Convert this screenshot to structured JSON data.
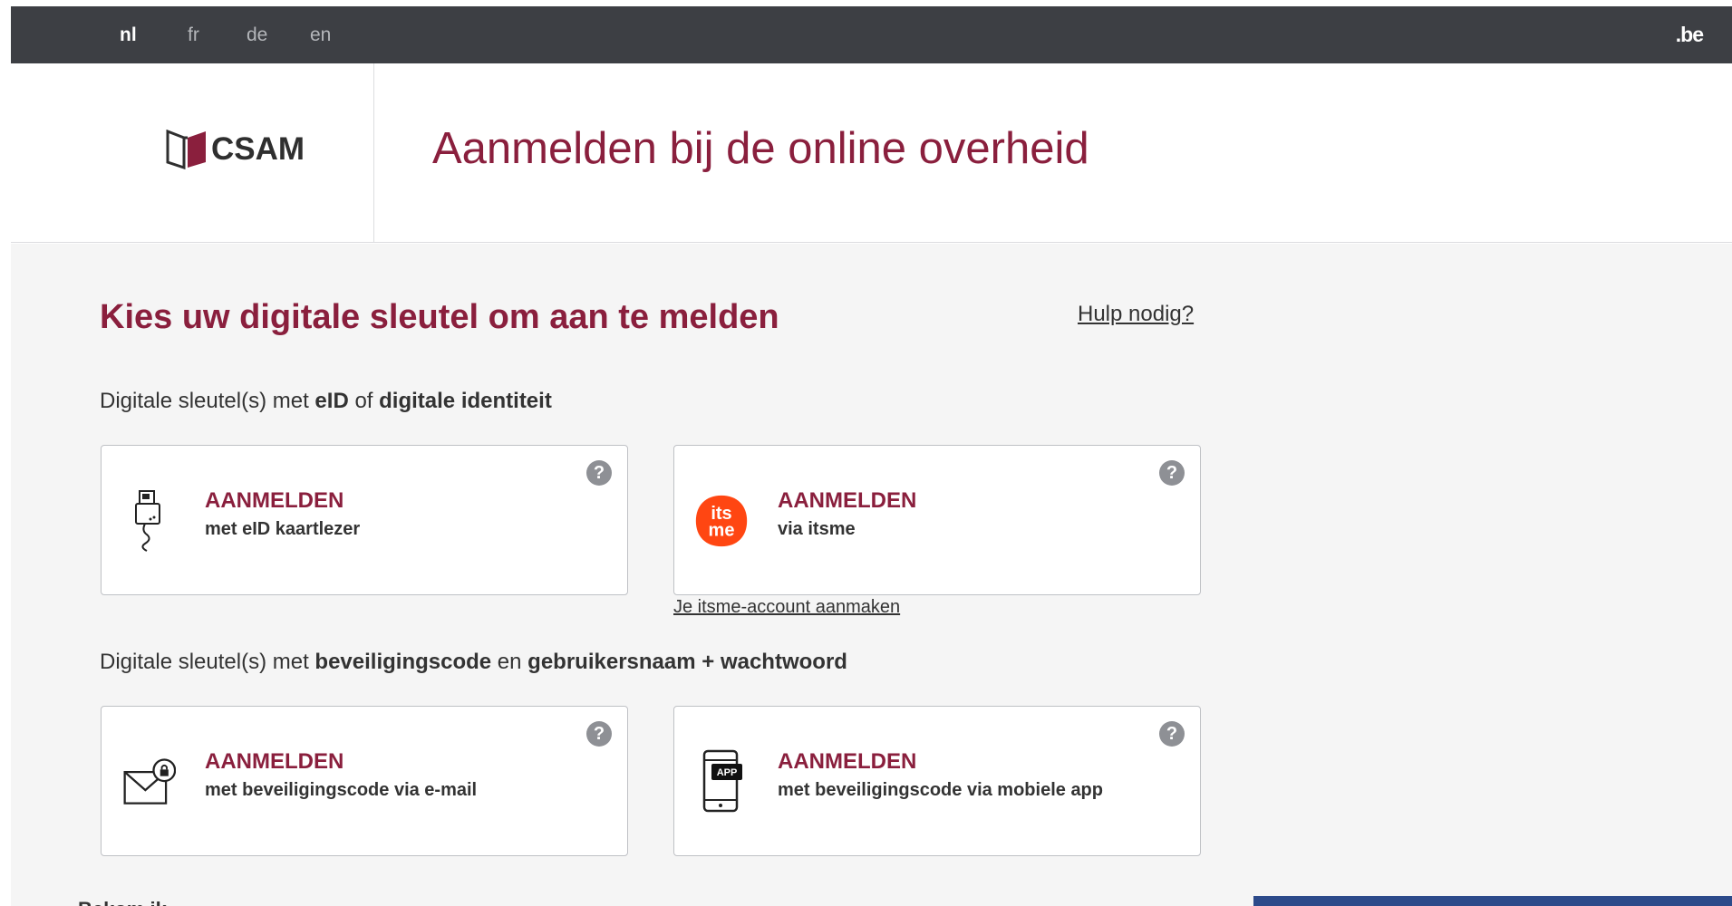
{
  "topbar": {
    "languages": [
      {
        "code": "nl",
        "active": true
      },
      {
        "code": "fr",
        "active": false
      },
      {
        "code": "de",
        "active": false
      },
      {
        "code": "en",
        "active": false
      }
    ],
    "be_logo": ".be"
  },
  "header": {
    "logo_text": "CSAM",
    "title": "Aanmelden bij de online overheid"
  },
  "main": {
    "section_title": "Kies uw digitale sleutel om aan te melden",
    "help_link": "Hulp nodig?",
    "group1": {
      "prefix": "Digitale sleutel(s) met ",
      "bold1": "eID",
      "mid": " of ",
      "bold2": "digitale identiteit"
    },
    "group2": {
      "prefix": "Digitale sleutel(s) met ",
      "bold1": "beveiligingscode",
      "mid": " en ",
      "bold2": "gebruikersnaam + wachtwoord"
    },
    "cards": [
      {
        "title": "AANMELDEN",
        "sub": "met eID kaartlezer",
        "icon": "card-reader-icon"
      },
      {
        "title": "AANMELDEN",
        "sub": "via itsme",
        "icon": "itsme-icon"
      },
      {
        "title": "AANMELDEN",
        "sub": "met beveiligingscode via e-mail",
        "icon": "envelope-lock-icon"
      },
      {
        "title": "AANMELDEN",
        "sub": "met beveiligingscode via mobiele app",
        "icon": "mobile-app-icon"
      }
    ],
    "help_glyph": "?",
    "itsme_link": "Je itsme-account aanmaken",
    "app_badge": "APP",
    "itsme_logo_top": "its",
    "itsme_logo_bottom": "me",
    "below_text": "Bekom ik   "
  },
  "colors": {
    "brand": "#8a1f3d",
    "topbar": "#3d3f44",
    "itsme": "#ff4612",
    "panel": "#2c4a8a"
  }
}
